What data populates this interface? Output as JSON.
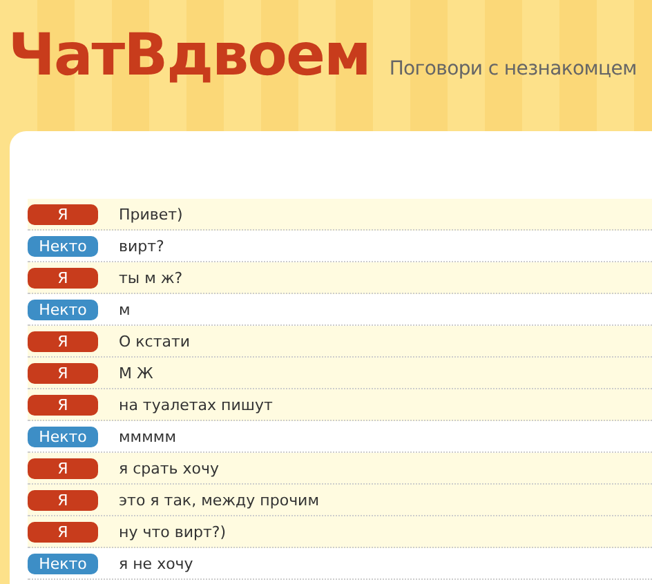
{
  "header": {
    "logo": "ЧатВдвоем",
    "tagline": "Поговори с незнакомцем"
  },
  "messages": [
    {
      "kind": "me",
      "author": "Я",
      "text": "Привет)"
    },
    {
      "kind": "stranger",
      "author": "Некто",
      "text": "вирт?"
    },
    {
      "kind": "me",
      "author": "Я",
      "text": "ты м ж?"
    },
    {
      "kind": "stranger",
      "author": "Некто",
      "text": "м"
    },
    {
      "kind": "me",
      "author": "Я",
      "text": "О кстати"
    },
    {
      "kind": "me",
      "author": "Я",
      "text": "М Ж"
    },
    {
      "kind": "me",
      "author": "Я",
      "text": "на туалетах пишут"
    },
    {
      "kind": "stranger",
      "author": "Некто",
      "text": "ммммм"
    },
    {
      "kind": "me",
      "author": "Я",
      "text": "я срать хочу"
    },
    {
      "kind": "me",
      "author": "Я",
      "text": "это я так, между прочим"
    },
    {
      "kind": "me",
      "author": "Я",
      "text": "ну что вирт?)"
    },
    {
      "kind": "stranger",
      "author": "Некто",
      "text": "я не хочу"
    }
  ]
}
